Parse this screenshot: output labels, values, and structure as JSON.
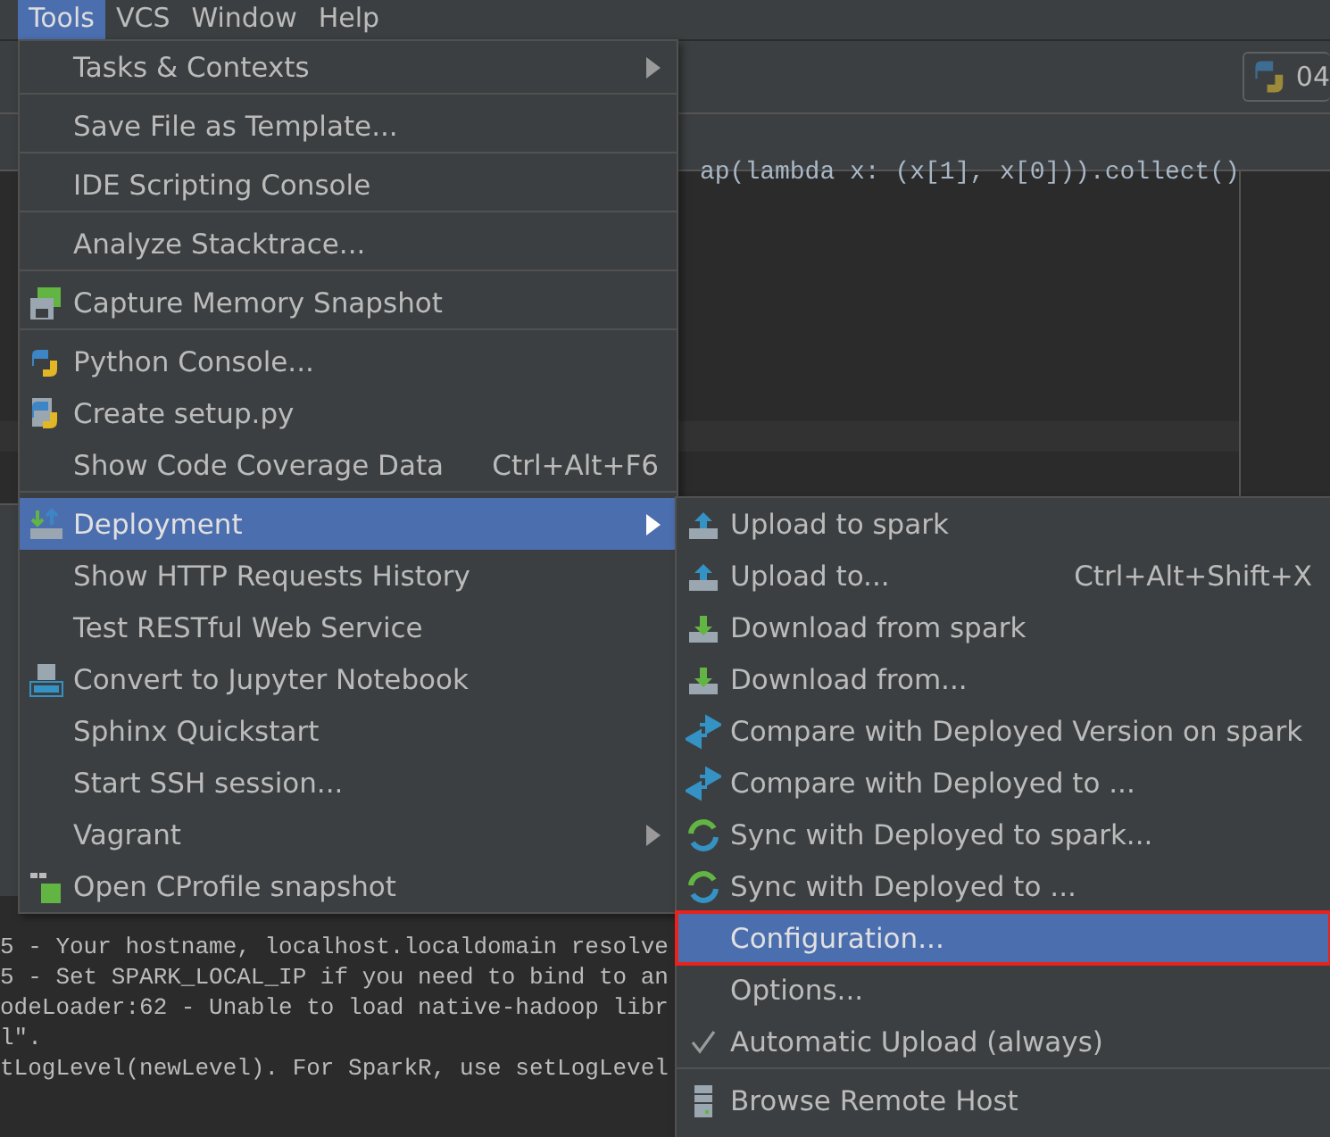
{
  "menu_bar": [
    {
      "label": "Tools",
      "selected": true
    },
    {
      "label": "VCS",
      "selected": false
    },
    {
      "label": "Window",
      "selected": false
    },
    {
      "label": "Help",
      "selected": false
    }
  ],
  "toolbar": {
    "interpreter_badge": "04"
  },
  "editor": {
    "code_line": "ap(lambda x: (x[1], x[0])).collect()"
  },
  "console": {
    "lines": [
      "5 - Your hostname, localhost.localdomain resolve",
      "5 - Set SPARK_LOCAL_IP if you need to bind to an",
      "odeLoader:62 - Unable to load native-hadoop libr",
      "l\".",
      "tLogLevel(newLevel). For SparkR, use setLogLevel"
    ]
  },
  "tools_menu": {
    "items": [
      {
        "label": "Tasks & Contexts",
        "kind": "plain",
        "selected": false,
        "has_submenu": true,
        "separator_after": true
      },
      {
        "label": "Save File as Template...",
        "kind": "plain",
        "selected": false,
        "has_submenu": false,
        "separator_after": true
      },
      {
        "label": "IDE Scripting Console",
        "kind": "plain",
        "selected": false,
        "has_submenu": false,
        "separator_after": true
      },
      {
        "label": "Analyze Stacktrace...",
        "kind": "plain",
        "selected": false,
        "has_submenu": false,
        "separator_after": true
      },
      {
        "label": "Capture Memory Snapshot",
        "kind": "memory",
        "selected": false,
        "has_submenu": false,
        "separator_after": true
      },
      {
        "label": "Python Console...",
        "kind": "python",
        "selected": false,
        "has_submenu": false,
        "separator_after": false
      },
      {
        "label": "Create setup.py",
        "kind": "setup",
        "selected": false,
        "has_submenu": false,
        "separator_after": false
      },
      {
        "label": "Show Code Coverage Data",
        "kind": "plain",
        "shortcut": "Ctrl+Alt+F6",
        "selected": false,
        "has_submenu": false,
        "separator_after": true
      },
      {
        "label": "Deployment",
        "kind": "deploy",
        "selected": true,
        "has_submenu": true,
        "separator_after": false
      },
      {
        "label": "Show HTTP Requests History",
        "kind": "plain",
        "selected": false,
        "has_submenu": false,
        "separator_after": false
      },
      {
        "label": "Test RESTful Web Service",
        "kind": "plain",
        "selected": false,
        "has_submenu": false,
        "separator_after": false
      },
      {
        "label": "Convert to Jupyter Notebook",
        "kind": "jupyter",
        "selected": false,
        "has_submenu": false,
        "separator_after": false
      },
      {
        "label": "Sphinx Quickstart",
        "kind": "plain",
        "selected": false,
        "has_submenu": false,
        "separator_after": false
      },
      {
        "label": "Start SSH session...",
        "kind": "plain",
        "selected": false,
        "has_submenu": false,
        "separator_after": false
      },
      {
        "label": "Vagrant",
        "kind": "plain",
        "selected": false,
        "has_submenu": true,
        "separator_after": false
      },
      {
        "label": "Open CProfile snapshot",
        "kind": "cprofile",
        "selected": false,
        "has_submenu": false,
        "separator_after": false
      }
    ]
  },
  "deployment_submenu": {
    "items": [
      {
        "label": "Upload to spark",
        "kind": "upload",
        "selected": false,
        "checked": false,
        "outlined": false,
        "separator_after": false
      },
      {
        "label": "Upload to...",
        "kind": "upload",
        "shortcut": "Ctrl+Alt+Shift+X",
        "selected": false,
        "checked": false,
        "outlined": false,
        "separator_after": false
      },
      {
        "label": "Download from spark",
        "kind": "download",
        "selected": false,
        "checked": false,
        "outlined": false,
        "separator_after": false
      },
      {
        "label": "Download from...",
        "kind": "download",
        "selected": false,
        "checked": false,
        "outlined": false,
        "separator_after": false
      },
      {
        "label": "Compare with Deployed Version on spark",
        "kind": "compare",
        "selected": false,
        "checked": false,
        "outlined": false,
        "separator_after": false
      },
      {
        "label": "Compare with Deployed to ...",
        "kind": "compare",
        "selected": false,
        "checked": false,
        "outlined": false,
        "separator_after": false
      },
      {
        "label": "Sync with Deployed to spark...",
        "kind": "sync",
        "selected": false,
        "checked": false,
        "outlined": false,
        "separator_after": false
      },
      {
        "label": "Sync with Deployed to ...",
        "kind": "sync",
        "selected": false,
        "checked": false,
        "outlined": false,
        "separator_after": false
      },
      {
        "label": "Configuration...",
        "kind": "plain",
        "selected": true,
        "checked": false,
        "outlined": true,
        "separator_after": false
      },
      {
        "label": "Options...",
        "kind": "plain",
        "selected": false,
        "checked": false,
        "outlined": false,
        "separator_after": false
      },
      {
        "label": "Automatic Upload (always)",
        "kind": "plain",
        "selected": false,
        "checked": true,
        "outlined": false,
        "separator_after": true
      },
      {
        "label": "Browse Remote Host",
        "kind": "server",
        "selected": false,
        "checked": false,
        "outlined": false,
        "separator_after": false
      }
    ]
  }
}
